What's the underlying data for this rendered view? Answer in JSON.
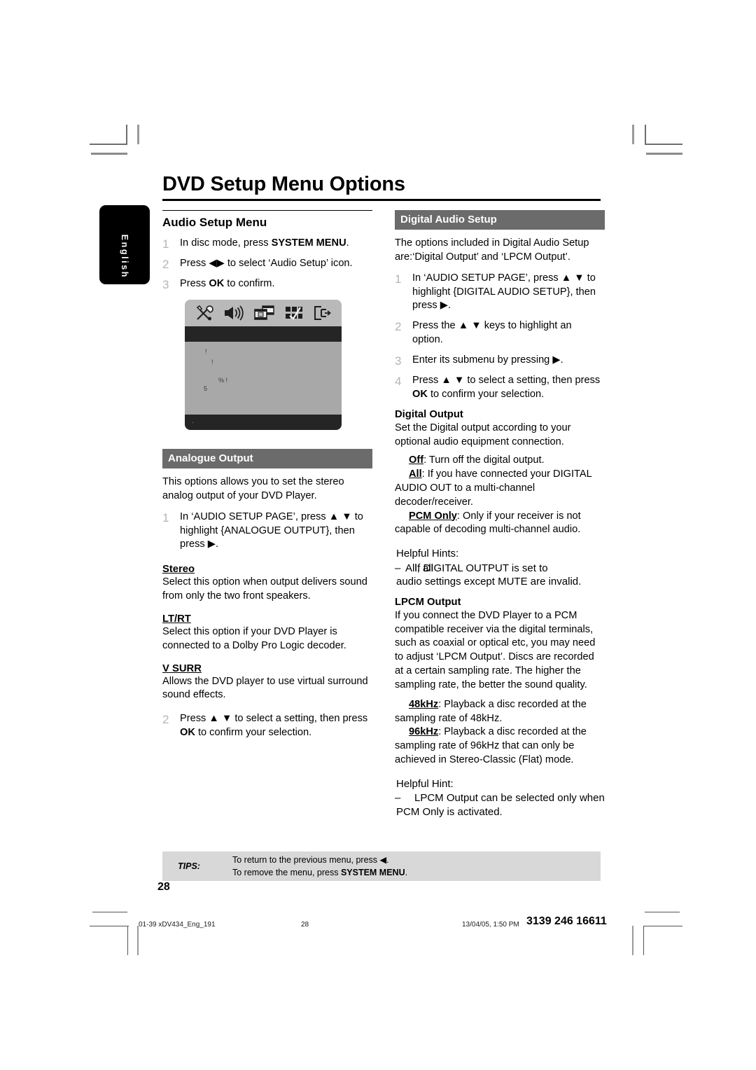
{
  "page": {
    "title": "DVD Setup Menu Options",
    "language_tab": "English",
    "page_number": "28"
  },
  "left_column": {
    "heading": "Audio Setup Menu",
    "steps": [
      {
        "num": "1",
        "html": "In disc mode, press <b>SYSTEM MENU</b>."
      },
      {
        "num": "2",
        "html": "Press ◀▶ to select ‘Audio Setup’ icon."
      },
      {
        "num": "3",
        "html": "Press <b>OK</b> to confirm."
      }
    ],
    "screenshot": {
      "icons": [
        "tools-icon",
        "speaker-icon",
        "film-icon",
        "preferences-grid-icon",
        "exit-icon"
      ],
      "artifact_glyphs": [
        "!",
        "!",
        "% !",
        "5",
        "."
      ]
    },
    "analogue": {
      "heading": "Analogue Output",
      "intro": "This options allows you to set the stereo analog output of your DVD Player.",
      "step1_num": "1",
      "step1_html": "In ‘AUDIO SETUP PAGE’, press ▲ ▼ to highlight {ANALOGUE OUTPUT}, then press ▶.",
      "options": [
        {
          "term": "Stereo",
          "desc": "Select this option when output delivers sound from only the two front speakers."
        },
        {
          "term": "LT/RT",
          "desc": "Select this option if your DVD Player is connected to a Dolby Pro Logic decoder."
        },
        {
          "term": "V SURR",
          "desc": "Allows the DVD player to use virtual surround sound effects."
        }
      ],
      "step2_num": "2",
      "step2_html": "Press ▲ ▼ to select a setting, then press <b>OK</b> to confirm your selection."
    }
  },
  "right_column": {
    "heading": "Digital Audio Setup",
    "intro": "The options included in Digital Audio Setup are:‘Digital Output’ and ‘LPCM Output’.",
    "steps": [
      {
        "num": "1",
        "html": "In ‘AUDIO SETUP PAGE’, press ▲ ▼ to highlight {DIGITAL AUDIO SETUP}, then press ▶."
      },
      {
        "num": "2",
        "html": "Press the ▲ ▼ keys to highlight an option."
      },
      {
        "num": "3",
        "html": "Enter its submenu by pressing ▶."
      },
      {
        "num": "4",
        "html": "Press ▲ ▼ to select a setting, then press <b>OK</b> to confirm your selection."
      }
    ],
    "digital_output": {
      "heading": "Digital Output",
      "intro": "Set the Digital output according to your optional audio equipment connection.",
      "options": [
        {
          "term": "Off",
          "desc": ": Turn off the digital output."
        },
        {
          "term": "All",
          "desc": ": If you have connected your DIGITAL AUDIO OUT to a multi-channel decoder/receiver."
        },
        {
          "term": "PCM Only",
          "desc": ": Only if your receiver is not capable of decoding multi-channel audio."
        }
      ],
      "hint_title": "Helpful Hints:",
      "hint_dash": "–",
      "hint_line1_a": "If DIGITAL OUTPUT is set to",
      "hint_line1_overlap": "All, all",
      "hint_line2": "audio settings except MUTE are invalid."
    },
    "lpcm_output": {
      "heading": "LPCM Output",
      "intro": "If you connect the DVD Player to a PCM compatible receiver via the digital terminals, such as coaxial or optical etc, you may need to adjust ‘LPCM Output’. Discs are recorded at a certain sampling rate. The higher the sampling rate, the better the sound quality.",
      "options": [
        {
          "term": "48kHz",
          "desc": ": Playback a disc recorded at the sampling rate of 48kHz."
        },
        {
          "term": "96kHz",
          "desc": ": Playback a disc recorded at the sampling rate of 96kHz that can only be achieved in Stereo-Classic (Flat) mode."
        }
      ],
      "hint_title": "Helpful Hint:",
      "hint_dash": "–",
      "hint_line1": "LPCM Output can be selected only when",
      "hint_line2": "PCM Only is activated."
    }
  },
  "tips": {
    "label": "TIPS:",
    "line1_html": "To return to the previous menu, press ◀.",
    "line2_html": "To remove the menu, press <b>SYSTEM MENU</b>."
  },
  "footer": {
    "file": "01-39 xDV434_Eng_191",
    "page": "28",
    "timestamp": "13/04/05, 1:50 PM",
    "code": "3139 246 16611"
  }
}
